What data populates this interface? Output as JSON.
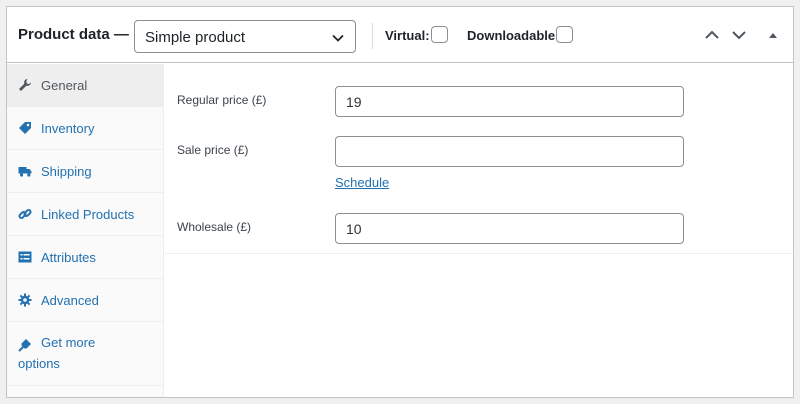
{
  "header": {
    "title": "Product data —",
    "product_type": "Simple product",
    "virtual_label": "Virtual:",
    "downloadable_label": "Downloadable:",
    "virtual_checked": false,
    "downloadable_checked": false
  },
  "sidebar": {
    "items": [
      {
        "label": "General",
        "icon": "wrench-icon",
        "active": true
      },
      {
        "label": "Inventory",
        "icon": "tag-icon"
      },
      {
        "label": "Shipping",
        "icon": "truck-icon"
      },
      {
        "label": "Linked Products",
        "icon": "link-icon"
      },
      {
        "label": "Attributes",
        "icon": "list-icon"
      },
      {
        "label": "Advanced",
        "icon": "gear-icon"
      },
      {
        "label_line1": "Get more",
        "label_line2": "options",
        "icon": "plug-icon"
      }
    ]
  },
  "general": {
    "regular_price_label": "Regular price (£)",
    "regular_price_value": "19",
    "sale_price_label": "Sale price (£)",
    "sale_price_value": "",
    "schedule_link": "Schedule",
    "wholesale_label": "Wholesale (£)",
    "wholesale_value": "10"
  },
  "colors": {
    "link": "#2271b1",
    "active_tab_bg": "#eeeeee",
    "border": "#c3c4c7"
  }
}
